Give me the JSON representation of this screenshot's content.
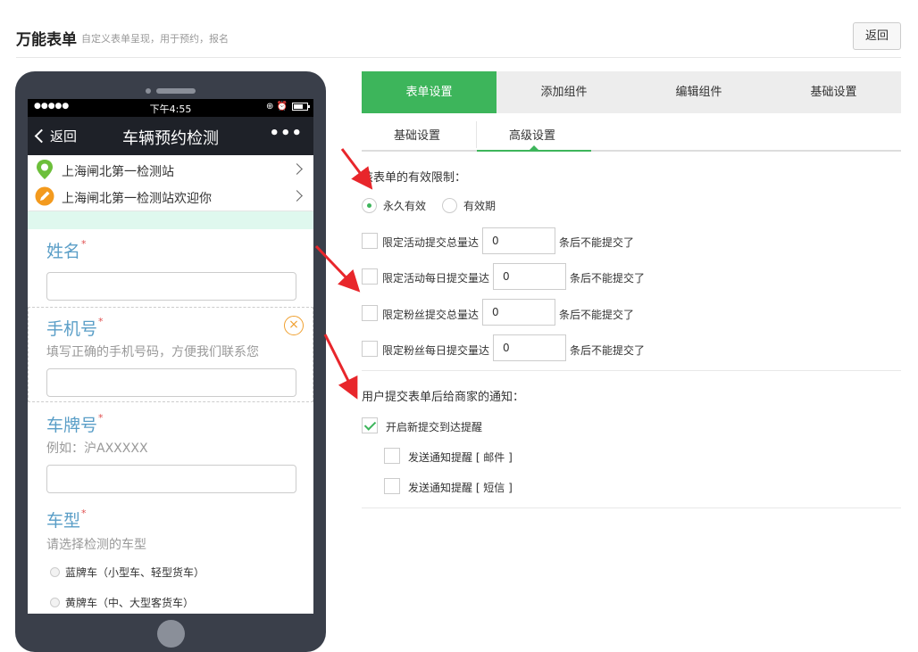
{
  "header": {
    "title": "万能表单",
    "subtitle": "自定义表单呈现，用于预约，报名",
    "back_label": "返回"
  },
  "phone": {
    "status": {
      "signal": "●●●●●",
      "time": "下午4:55",
      "icons": "⊕ ⏰"
    },
    "nav": {
      "back_label": "返回",
      "title": "车辆预约检测",
      "more": "•••"
    },
    "rows": [
      {
        "text": "上海闸北第一检测站",
        "icon": "location-pin-icon"
      },
      {
        "text": "上海闸北第一检测站欢迎你",
        "icon": "pencil-icon"
      }
    ],
    "fields": {
      "name": {
        "label": "姓名",
        "star": "*"
      },
      "phone": {
        "label": "手机号",
        "star": "*",
        "hint": "填写正确的手机号码，方便我们联系您",
        "close": "×"
      },
      "plate": {
        "label": "车牌号",
        "star": "*",
        "hint": "例如：沪AXXXXX"
      },
      "type": {
        "label": "车型",
        "star": "*",
        "hint": "请选择检测的车型",
        "options": [
          "蓝牌车（小型车、轻型货车）",
          "黄牌车（中、大型客货车）"
        ]
      }
    }
  },
  "tabs": [
    {
      "label": "表单设置",
      "active": true
    },
    {
      "label": "添加组件",
      "active": false
    },
    {
      "label": "编辑组件",
      "active": false
    },
    {
      "label": "基础设置",
      "active": false
    }
  ],
  "subtabs": [
    {
      "label": "基础设置",
      "active": false
    },
    {
      "label": "高级设置",
      "active": true
    }
  ],
  "validity": {
    "label": "该表单的有效限制：",
    "options": [
      {
        "label": "永久有效",
        "selected": true
      },
      {
        "label": "有效期",
        "selected": false
      }
    ]
  },
  "limits": [
    {
      "label": "限定活动提交总量达",
      "value": "0",
      "suffix": "条后不能提交了"
    },
    {
      "label": "限定活动每日提交量达",
      "value": "0",
      "suffix": "条后不能提交了"
    },
    {
      "label": "限定粉丝提交总量达",
      "value": "0",
      "suffix": "条后不能提交了"
    },
    {
      "label": "限定粉丝每日提交量达",
      "value": "0",
      "suffix": "条后不能提交了"
    }
  ],
  "notify": {
    "label": "用户提交表单后给商家的通知：",
    "main": {
      "label": "开启新提交到达提醒",
      "checked": true
    },
    "email": {
      "label": "发送通知提醒 [ 邮件 ]",
      "checked": false
    },
    "sms": {
      "label": "发送通知提醒 [ 短信 ]",
      "checked": false
    }
  },
  "colors": {
    "accent": "#3db55b",
    "label_blue": "#5a9ec7",
    "arrow_red": "#e8262b"
  }
}
